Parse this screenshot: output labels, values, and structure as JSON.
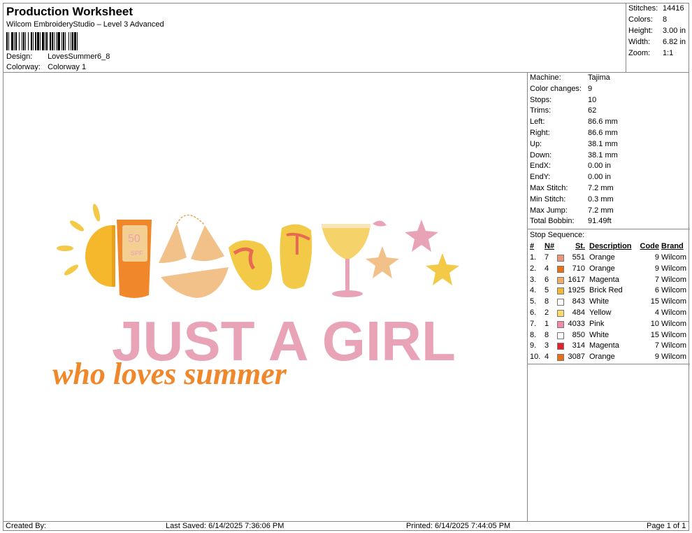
{
  "header": {
    "title": "Production Worksheet",
    "software": "Wilcom EmbroideryStudio – Level 3 Advanced",
    "design_label": "Design:",
    "design_value": "LovesSummer6_8",
    "colorway_label": "Colorway:",
    "colorway_value": "Colorway 1"
  },
  "summary": [
    {
      "label": "Stitches:",
      "value": "14416"
    },
    {
      "label": "Colors:",
      "value": "8"
    },
    {
      "label": "Height:",
      "value": "3.00 in"
    },
    {
      "label": "Width:",
      "value": "6.82 in"
    },
    {
      "label": "Zoom:",
      "value": "1:1"
    }
  ],
  "machine": [
    {
      "label": "Machine:",
      "value": "Tajima"
    },
    {
      "label": "Color changes:",
      "value": "9"
    },
    {
      "label": "Stops:",
      "value": "10"
    },
    {
      "label": "Trims:",
      "value": "62"
    },
    {
      "label": "Left:",
      "value": "86.6 mm"
    },
    {
      "label": "Right:",
      "value": "86.6 mm"
    },
    {
      "label": "Up:",
      "value": "38.1 mm"
    },
    {
      "label": "Down:",
      "value": "38.1 mm"
    },
    {
      "label": "EndX:",
      "value": "0.00 in"
    },
    {
      "label": "EndY:",
      "value": "0.00 in"
    },
    {
      "label": "Max Stitch:",
      "value": "7.2 mm"
    },
    {
      "label": "Min Stitch:",
      "value": "0.3 mm"
    },
    {
      "label": "Max Jump:",
      "value": "7.2 mm"
    },
    {
      "label": "Total Bobbin:",
      "value": "91.49ft"
    }
  ],
  "stop_sequence": {
    "title": "Stop Sequence:",
    "headers": {
      "idx": "#",
      "n": "N#",
      "st": "St.",
      "desc": "Description",
      "code": "Code",
      "brand": "Brand"
    },
    "rows": [
      {
        "idx": "1.",
        "n": "7",
        "color": "#e8967a",
        "st": "551",
        "desc": "Orange",
        "code": "9",
        "brand": "Wilcom"
      },
      {
        "idx": "2.",
        "n": "4",
        "color": "#e96f10",
        "st": "710",
        "desc": "Orange",
        "code": "9",
        "brand": "Wilcom"
      },
      {
        "idx": "3.",
        "n": "6",
        "color": "#f0ac6a",
        "st": "1617",
        "desc": "Magenta",
        "code": "7",
        "brand": "Wilcom"
      },
      {
        "idx": "4.",
        "n": "5",
        "color": "#f1b93c",
        "st": "1925",
        "desc": "Brick Red",
        "code": "6",
        "brand": "Wilcom"
      },
      {
        "idx": "5.",
        "n": "8",
        "color": "#ffffff",
        "st": "843",
        "desc": "White",
        "code": "15",
        "brand": "Wilcom"
      },
      {
        "idx": "6.",
        "n": "2",
        "color": "#fbdc6a",
        "st": "484",
        "desc": "Yellow",
        "code": "4",
        "brand": "Wilcom"
      },
      {
        "idx": "7.",
        "n": "1",
        "color": "#f28aa8",
        "st": "4033",
        "desc": "Pink",
        "code": "10",
        "brand": "Wilcom"
      },
      {
        "idx": "8.",
        "n": "8",
        "color": "#ffffff",
        "st": "850",
        "desc": "White",
        "code": "15",
        "brand": "Wilcom"
      },
      {
        "idx": "9.",
        "n": "3",
        "color": "#e0242a",
        "st": "314",
        "desc": "Magenta",
        "code": "7",
        "brand": "Wilcom"
      },
      {
        "idx": "10.",
        "n": "4",
        "color": "#e96f10",
        "st": "3087",
        "desc": "Orange",
        "code": "9",
        "brand": "Wilcom"
      }
    ]
  },
  "design_art": {
    "label": "50",
    "label2": "SPF",
    "headline": "JUST A GIRL",
    "script": "who loves summer",
    "colors": {
      "sun": "#f5b72c",
      "orange": "#f0872a",
      "pink": "#e9a3b7",
      "tan": "#f2c089",
      "yellow": "#f3c948",
      "red": "#e96a52"
    }
  },
  "footer": {
    "created_by": "Created By:",
    "last_saved": "Last Saved: 6/14/2025 7:36:06 PM",
    "printed": "Printed: 6/14/2025 7:44:05 PM",
    "page": "Page 1 of 1"
  }
}
